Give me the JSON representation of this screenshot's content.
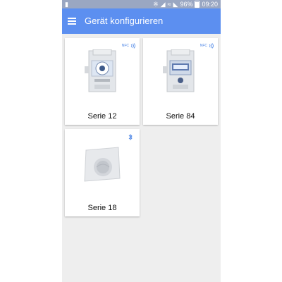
{
  "status_bar": {
    "left_icon": "sd-card-icon",
    "right_icons": [
      "bluetooth-icon",
      "vibrate-off-icon",
      "wifi-icon",
      "signal-icon"
    ],
    "battery": "96%",
    "time": "09:20"
  },
  "app_bar": {
    "title": "Gerät konfigurieren",
    "menu_icon": "hamburger-menu-icon"
  },
  "devices": [
    {
      "label": "Serie 12",
      "badge": "NFC",
      "badge_icon": "nfc-icon"
    },
    {
      "label": "Serie 84",
      "badge": "NFC",
      "badge_icon": "nfc-icon"
    },
    {
      "label": "Serie 18",
      "badge_icon": "bluetooth-icon"
    }
  ],
  "colors": {
    "app_bar": "#5c8ff0",
    "accent": "#4d86e6",
    "background": "#eeeeee"
  }
}
